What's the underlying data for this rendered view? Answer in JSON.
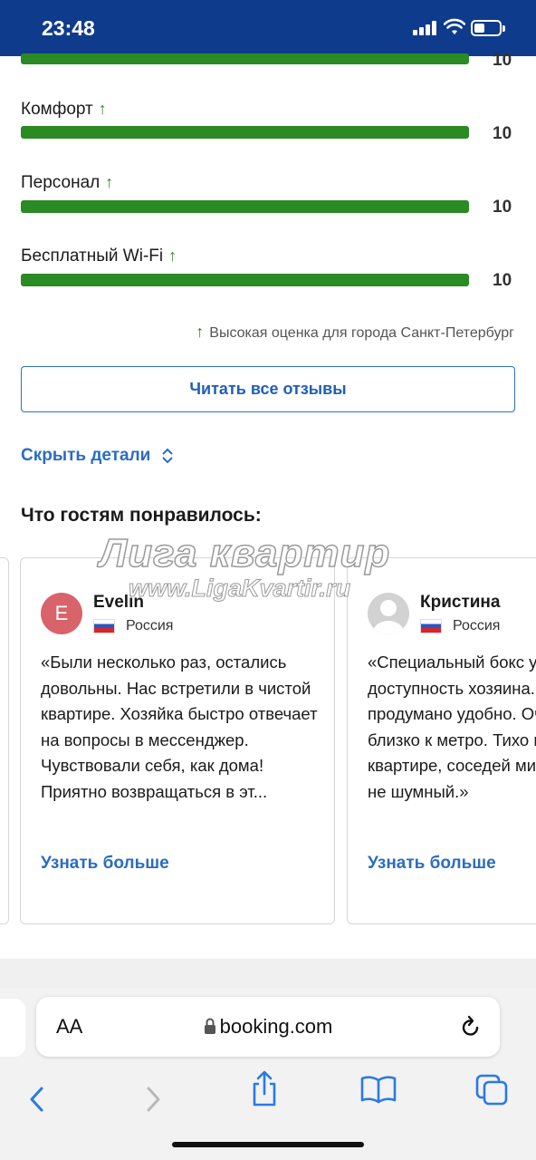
{
  "status": {
    "time": "23:48"
  },
  "ratings": [
    {
      "label": "",
      "score": "10"
    },
    {
      "label": "Комфорт",
      "score": "10"
    },
    {
      "label": "Персонал",
      "score": "10"
    },
    {
      "label": "Бесплатный Wi-Fi",
      "score": "10"
    }
  ],
  "up_arrow": "↑",
  "high_rating_note": "Высокая оценка для города Санкт-Петербург",
  "read_all_button": "Читать все отзывы",
  "hide_details_link": "Скрыть детали",
  "liked_title": "Что гостям понравилось:",
  "watermark": {
    "line1": "Лига квартир",
    "line2": "www.LigaKvartir.ru"
  },
  "reviews": [
    {
      "initial": "E",
      "name": "Evelin",
      "country": "Россия",
      "text": "«Были несколько раз, остались довольны. Нас встретили в чистой квартире. Хозяйка быстро отвечает на вопросы в мессенджер. Чувствовали себя, как дома! Приятно возвращаться в эт...",
      "more_link": "Узнать больше"
    },
    {
      "name": "Кристина",
      "country": "Россия",
      "text": "«Специальный бокс у двери, доступность хозяина. Все продумано удобно. Очень близко к метро. Тихо в квартире, соседей минимум, не шумный.»",
      "more_link": "Узнать больше"
    }
  ],
  "browser": {
    "aa_label": "AA",
    "url": "booking.com"
  },
  "colors": {
    "status_bar": "#0f3b8c",
    "rating_bar": "#2a8a23",
    "link": "#2b6cc0",
    "avatar_e": "#d8636a"
  }
}
